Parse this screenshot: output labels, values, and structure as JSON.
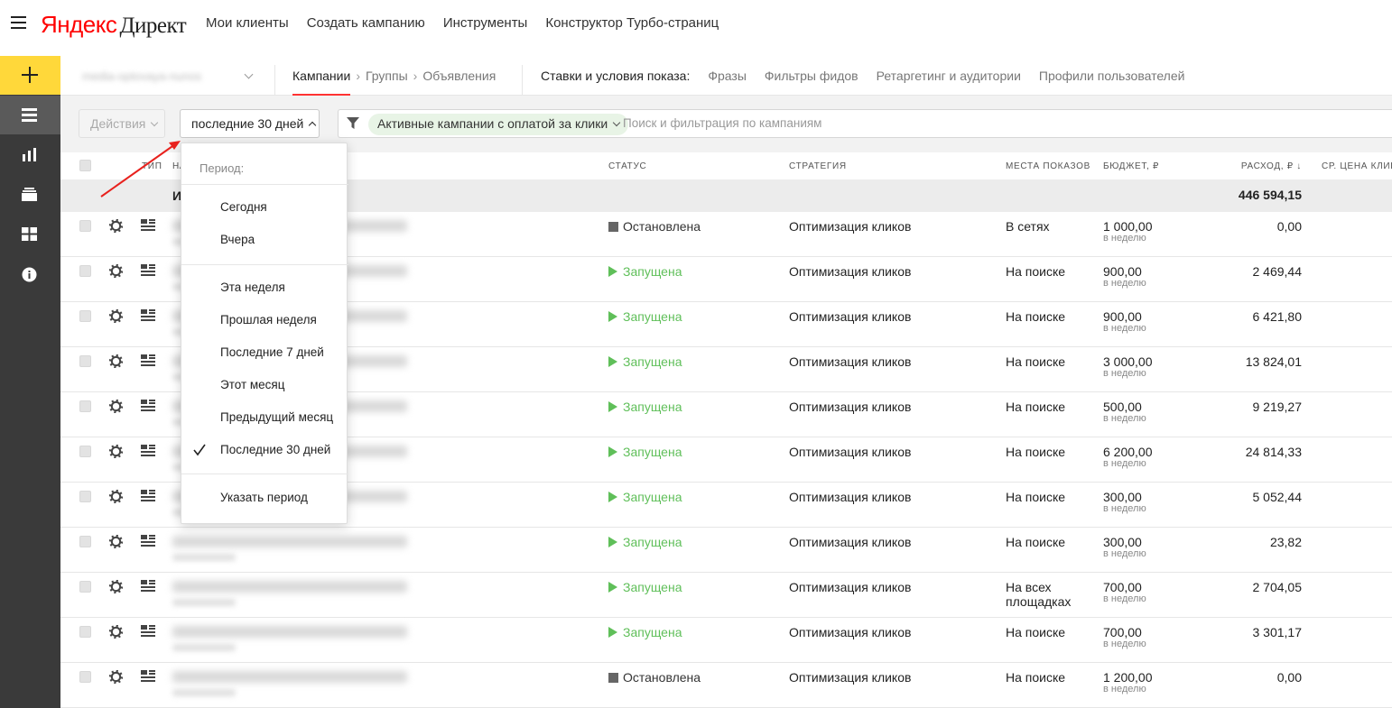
{
  "header": {
    "logo_brand": "Яндекс",
    "logo_product": "Директ",
    "nav": [
      "Мои клиенты",
      "Создать кампанию",
      "Инструменты",
      "Конструктор Турбо-страниц"
    ]
  },
  "subheader": {
    "account": "media-optovaya-nunos",
    "crumbs": [
      "Кампании",
      "Группы",
      "Объявления"
    ],
    "bids_label": "Ставки и условия показа:",
    "bids_links": [
      "Фразы",
      "Фильтры фидов",
      "Ретаргетинг и аудитории",
      "Профили пользователей"
    ]
  },
  "toolbar": {
    "actions_label": "Действия",
    "period_label": "последние 30 дней",
    "filter_chip": "Активные кампании с оплатой за клики",
    "filter_placeholder": "Поиск и фильтрация по кампаниям"
  },
  "table": {
    "headers": {
      "type": "ТИП",
      "name": "НА",
      "status": "СТАТУС",
      "strategy": "СТРАТЕГИЯ",
      "places": "МЕСТА ПОКАЗОВ",
      "budget": "БЮДЖЕТ, ₽",
      "spend": "РАСХОД, ₽ ↓",
      "avg": "СР. ЦЕНА КЛИКА"
    },
    "totals_label": "И",
    "totals_spend": "446 594,15",
    "per_week": "в неделю",
    "rows": [
      {
        "status": "Остановлена",
        "state": "stop",
        "strategy": "Оптимизация кликов",
        "places": "В сетях",
        "budget": "1 000,00",
        "spend": "0,00"
      },
      {
        "status": "Запущена",
        "state": "run",
        "strategy": "Оптимизация кликов",
        "places": "На поиске",
        "budget": "900,00",
        "spend": "2 469,44"
      },
      {
        "status": "Запущена",
        "state": "run",
        "strategy": "Оптимизация кликов",
        "places": "На поиске",
        "budget": "900,00",
        "spend": "6 421,80"
      },
      {
        "status": "Запущена",
        "state": "run",
        "strategy": "Оптимизация кликов",
        "places": "На поиске",
        "budget": "3 000,00",
        "spend": "13 824,01"
      },
      {
        "status": "Запущена",
        "state": "run",
        "strategy": "Оптимизация кликов",
        "places": "На поиске",
        "budget": "500,00",
        "spend": "9 219,27"
      },
      {
        "status": "Запущена",
        "state": "run",
        "strategy": "Оптимизация кликов",
        "places": "На поиске",
        "budget": "6 200,00",
        "spend": "24 814,33"
      },
      {
        "status": "Запущена",
        "state": "run",
        "strategy": "Оптимизация кликов",
        "places": "На поиске",
        "budget": "300,00",
        "spend": "5 052,44"
      },
      {
        "status": "Запущена",
        "state": "run",
        "strategy": "Оптимизация кликов",
        "places": "На поиске",
        "budget": "300,00",
        "spend": "23,82"
      },
      {
        "status": "Запущена",
        "state": "run",
        "strategy": "Оптимизация кликов",
        "places": "На всех площадках",
        "budget": "700,00",
        "spend": "2 704,05"
      },
      {
        "status": "Запущена",
        "state": "run",
        "strategy": "Оптимизация кликов",
        "places": "На поиске",
        "budget": "700,00",
        "spend": "3 301,17"
      },
      {
        "status": "Остановлена",
        "state": "stop",
        "strategy": "Оптимизация кликов",
        "places": "На поиске",
        "budget": "1 200,00",
        "spend": "0,00"
      }
    ]
  },
  "dropdown": {
    "heading": "Период:",
    "group1": [
      "Сегодня",
      "Вчера"
    ],
    "group2": [
      "Эта неделя",
      "Прошлая неделя",
      "Последние 7 дней",
      "Этот месяц",
      "Предыдущий месяц",
      "Последние 30 дней"
    ],
    "selected": "Последние 30 дней",
    "custom": "Указать период"
  },
  "colors": {
    "accent_yellow": "#ffd83a",
    "running_green": "#5fbf59",
    "sidebar_dark": "#3a3a3a",
    "annotation_red": "#e8211d"
  }
}
